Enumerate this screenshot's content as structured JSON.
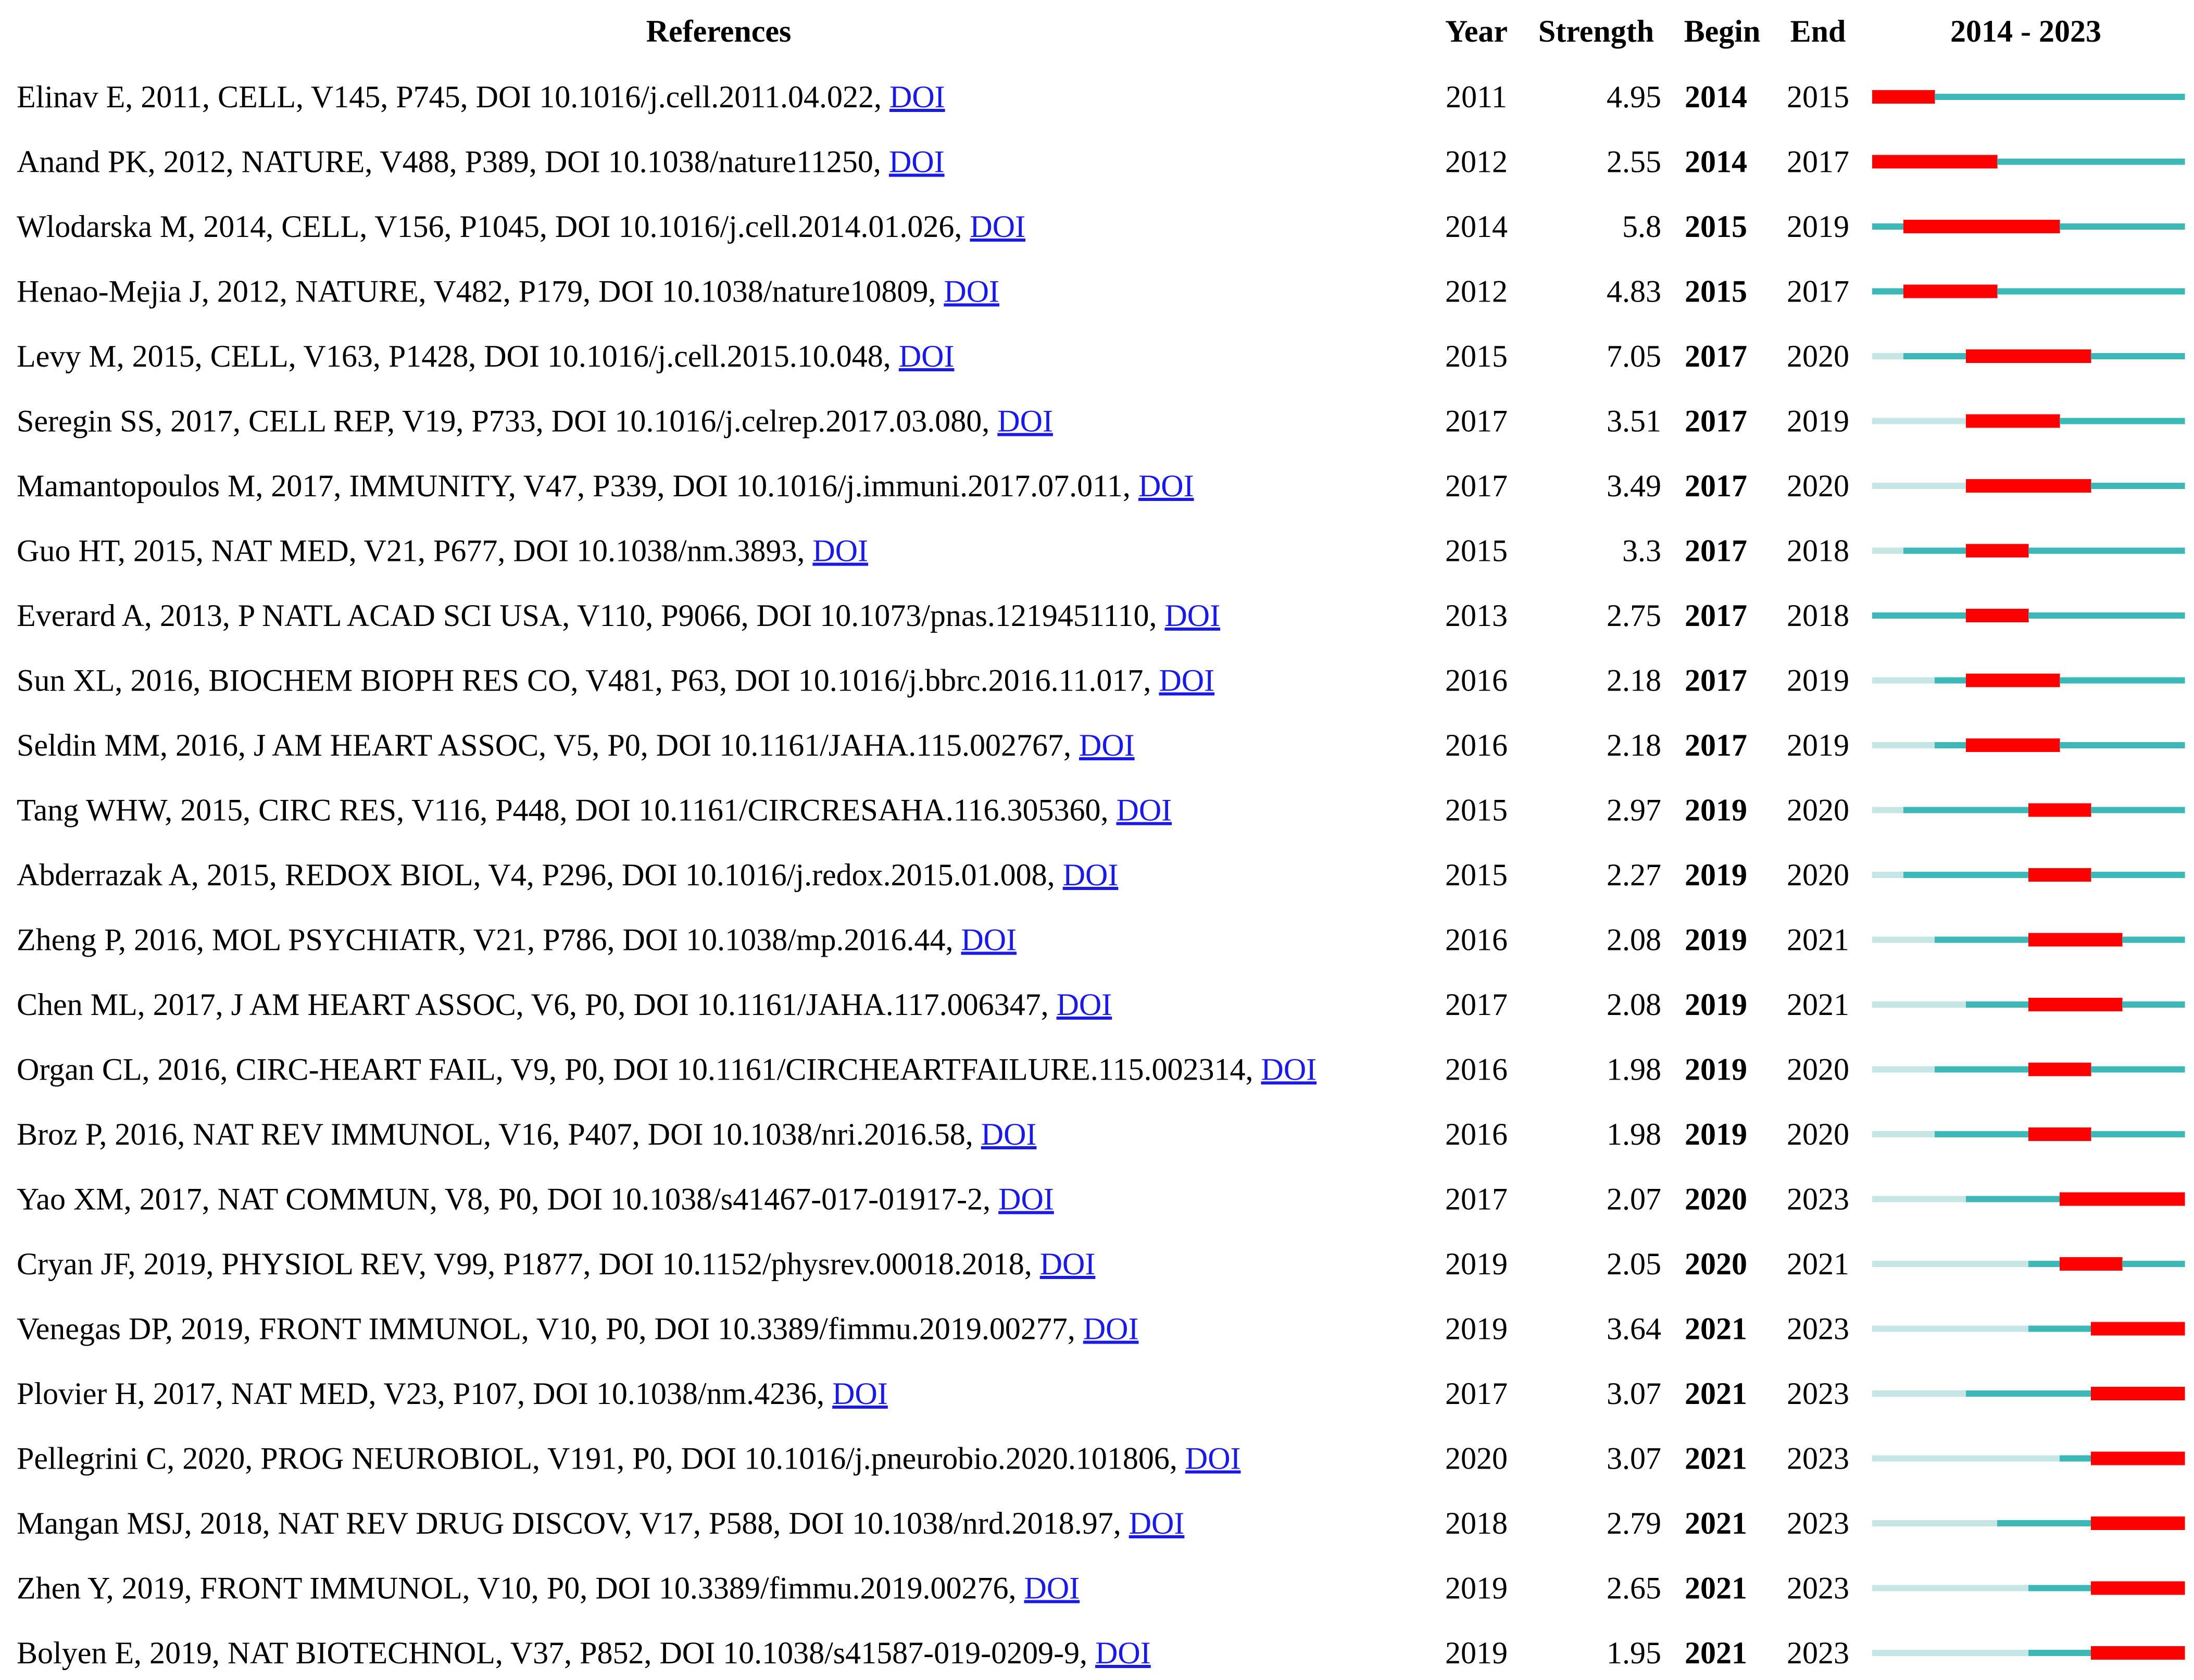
{
  "chart_data": {
    "type": "table",
    "headers": {
      "references": "References",
      "year": "Year",
      "strength": "Strength",
      "begin": "Begin",
      "end": "End",
      "timeline": "2014 - 2023"
    },
    "range": [
      2014,
      2023
    ],
    "doi_label": "DOI",
    "colors": {
      "burst": "#ff0000",
      "active": "#3cb8b8",
      "before": "#c6e6e6",
      "link": "#1a1ae6"
    },
    "rows": [
      {
        "reference": "Elinav E, 2011, CELL, V145, P745, DOI 10.1016/j.cell.2011.04.022, ",
        "year": "2011",
        "strength": "4.95",
        "begin": "2014",
        "end": "2015"
      },
      {
        "reference": "Anand PK, 2012, NATURE, V488, P389, DOI 10.1038/nature11250, ",
        "year": "2012",
        "strength": "2.55",
        "begin": "2014",
        "end": "2017"
      },
      {
        "reference": "Wlodarska M, 2014, CELL, V156, P1045, DOI 10.1016/j.cell.2014.01.026, ",
        "year": "2014",
        "strength": "5.8",
        "begin": "2015",
        "end": "2019"
      },
      {
        "reference": "Henao-Mejia J, 2012, NATURE, V482, P179, DOI 10.1038/nature10809, ",
        "year": "2012",
        "strength": "4.83",
        "begin": "2015",
        "end": "2017"
      },
      {
        "reference": "Levy M, 2015, CELL, V163, P1428, DOI 10.1016/j.cell.2015.10.048, ",
        "year": "2015",
        "strength": "7.05",
        "begin": "2017",
        "end": "2020"
      },
      {
        "reference": "Seregin SS, 2017, CELL REP, V19, P733, DOI 10.1016/j.celrep.2017.03.080, ",
        "year": "2017",
        "strength": "3.51",
        "begin": "2017",
        "end": "2019"
      },
      {
        "reference": "Mamantopoulos M, 2017, IMMUNITY, V47, P339, DOI 10.1016/j.immuni.2017.07.011, ",
        "year": "2017",
        "strength": "3.49",
        "begin": "2017",
        "end": "2020"
      },
      {
        "reference": "Guo HT, 2015, NAT MED, V21, P677, DOI 10.1038/nm.3893, ",
        "year": "2015",
        "strength": "3.3",
        "begin": "2017",
        "end": "2018"
      },
      {
        "reference": "Everard A, 2013, P NATL ACAD SCI USA, V110, P9066, DOI 10.1073/pnas.1219451110, ",
        "year": "2013",
        "strength": "2.75",
        "begin": "2017",
        "end": "2018"
      },
      {
        "reference": "Sun XL, 2016, BIOCHEM BIOPH RES CO, V481, P63, DOI 10.1016/j.bbrc.2016.11.017, ",
        "year": "2016",
        "strength": "2.18",
        "begin": "2017",
        "end": "2019"
      },
      {
        "reference": "Seldin MM, 2016, J AM HEART ASSOC, V5, P0, DOI 10.1161/JAHA.115.002767, ",
        "year": "2016",
        "strength": "2.18",
        "begin": "2017",
        "end": "2019"
      },
      {
        "reference": "Tang WHW, 2015, CIRC RES, V116, P448, DOI 10.1161/CIRCRESAHA.116.305360, ",
        "year": "2015",
        "strength": "2.97",
        "begin": "2019",
        "end": "2020"
      },
      {
        "reference": "Abderrazak A, 2015, REDOX BIOL, V4, P296, DOI 10.1016/j.redox.2015.01.008, ",
        "year": "2015",
        "strength": "2.27",
        "begin": "2019",
        "end": "2020"
      },
      {
        "reference": "Zheng P, 2016, MOL PSYCHIATR, V21, P786, DOI 10.1038/mp.2016.44, ",
        "year": "2016",
        "strength": "2.08",
        "begin": "2019",
        "end": "2021"
      },
      {
        "reference": "Chen ML, 2017, J AM HEART ASSOC, V6, P0, DOI 10.1161/JAHA.117.006347, ",
        "year": "2017",
        "strength": "2.08",
        "begin": "2019",
        "end": "2021"
      },
      {
        "reference": "Organ CL, 2016, CIRC-HEART FAIL, V9, P0, DOI 10.1161/CIRCHEARTFAILURE.115.002314, ",
        "year": "2016",
        "strength": "1.98",
        "begin": "2019",
        "end": "2020"
      },
      {
        "reference": "Broz P, 2016, NAT REV IMMUNOL, V16, P407, DOI 10.1038/nri.2016.58, ",
        "year": "2016",
        "strength": "1.98",
        "begin": "2019",
        "end": "2020"
      },
      {
        "reference": "Yao XM, 2017, NAT COMMUN, V8, P0, DOI 10.1038/s41467-017-01917-2, ",
        "year": "2017",
        "strength": "2.07",
        "begin": "2020",
        "end": "2023"
      },
      {
        "reference": "Cryan JF, 2019, PHYSIOL REV, V99, P1877, DOI 10.1152/physrev.00018.2018, ",
        "year": "2019",
        "strength": "2.05",
        "begin": "2020",
        "end": "2021"
      },
      {
        "reference": "Venegas DP, 2019, FRONT IMMUNOL, V10, P0, DOI 10.3389/fimmu.2019.00277, ",
        "year": "2019",
        "strength": "3.64",
        "begin": "2021",
        "end": "2023"
      },
      {
        "reference": "Plovier H, 2017, NAT MED, V23, P107, DOI 10.1038/nm.4236, ",
        "year": "2017",
        "strength": "3.07",
        "begin": "2021",
        "end": "2023"
      },
      {
        "reference": "Pellegrini C, 2020, PROG NEUROBIOL, V191, P0, DOI 10.1016/j.pneurobio.2020.101806, ",
        "year": "2020",
        "strength": "3.07",
        "begin": "2021",
        "end": "2023"
      },
      {
        "reference": "Mangan MSJ, 2018, NAT REV DRUG DISCOV, V17, P588, DOI 10.1038/nrd.2018.97, ",
        "year": "2018",
        "strength": "2.79",
        "begin": "2021",
        "end": "2023"
      },
      {
        "reference": "Zhen Y, 2019, FRONT IMMUNOL, V10, P0, DOI 10.3389/fimmu.2019.00276, ",
        "year": "2019",
        "strength": "2.65",
        "begin": "2021",
        "end": "2023"
      },
      {
        "reference": "Bolyen E, 2019, NAT BIOTECHNOL, V37, P852, DOI 10.1038/s41587-019-0209-9, ",
        "year": "2019",
        "strength": "1.95",
        "begin": "2021",
        "end": "2023"
      }
    ]
  }
}
